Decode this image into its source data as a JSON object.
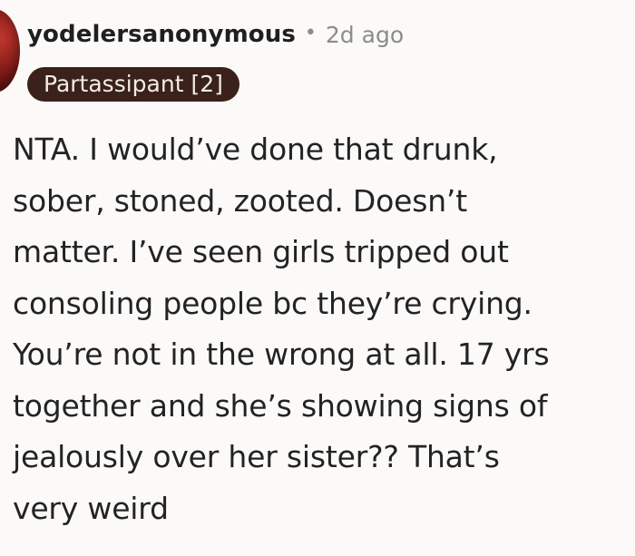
{
  "comment": {
    "author": "yodelersanonymous",
    "separator": "•",
    "age": "2d ago",
    "flair": "Partassipant [2]",
    "avatar_icon": "avatar-icon",
    "colors": {
      "background": "#fbfaf8",
      "text": "#232323",
      "muted": "#8c8c8c",
      "flair_bg": "#3a2119",
      "flair_text": "#f2ece8",
      "avatar": "#8f1f1b"
    },
    "body_lines": [
      "NTA. I would’ve done that drunk,",
      "sober, stoned, zooted. Doesn’t",
      "matter. I’ve seen girls tripped out",
      "consoling people bc they’re crying.",
      "You’re not in the wrong at all. 17 yrs",
      "together and she’s showing signs of",
      "jealously over her sister?? That’s",
      "very weird"
    ]
  }
}
